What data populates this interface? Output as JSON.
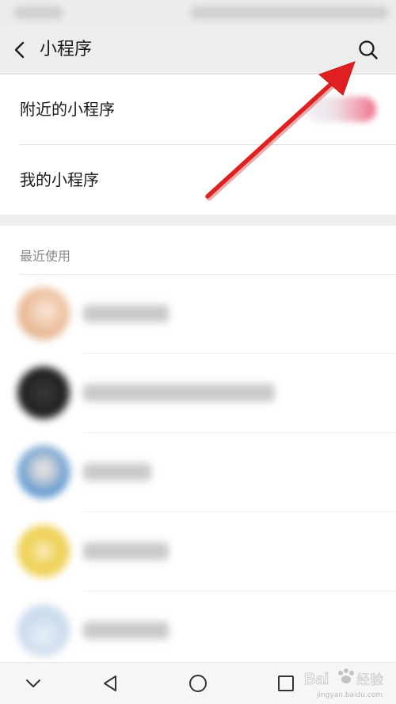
{
  "header": {
    "title": "小程序",
    "back_icon": "chevron-left-icon",
    "search_icon": "search-icon"
  },
  "menu": {
    "items": [
      {
        "label": "附近的小程序"
      },
      {
        "label": "我的小程序"
      }
    ]
  },
  "recent": {
    "section_label": "最近使用",
    "items": [
      {
        "avatar_color": "#e8b48f"
      },
      {
        "avatar_color": "#262626"
      },
      {
        "avatar_color": "#5b95d0"
      },
      {
        "avatar_color": "#eccf4c"
      },
      {
        "avatar_color": "#c9d9ec"
      }
    ]
  },
  "navigation": {
    "buttons": [
      "chevron-down-icon",
      "back-triangle-icon",
      "home-circle-icon",
      "recents-square-icon"
    ]
  },
  "watermark": {
    "text": "Bai 经验",
    "subtext": "jingyan.baidu.com"
  },
  "colors": {
    "annotation_arrow": "#e02020",
    "header_background": "#ededed"
  }
}
